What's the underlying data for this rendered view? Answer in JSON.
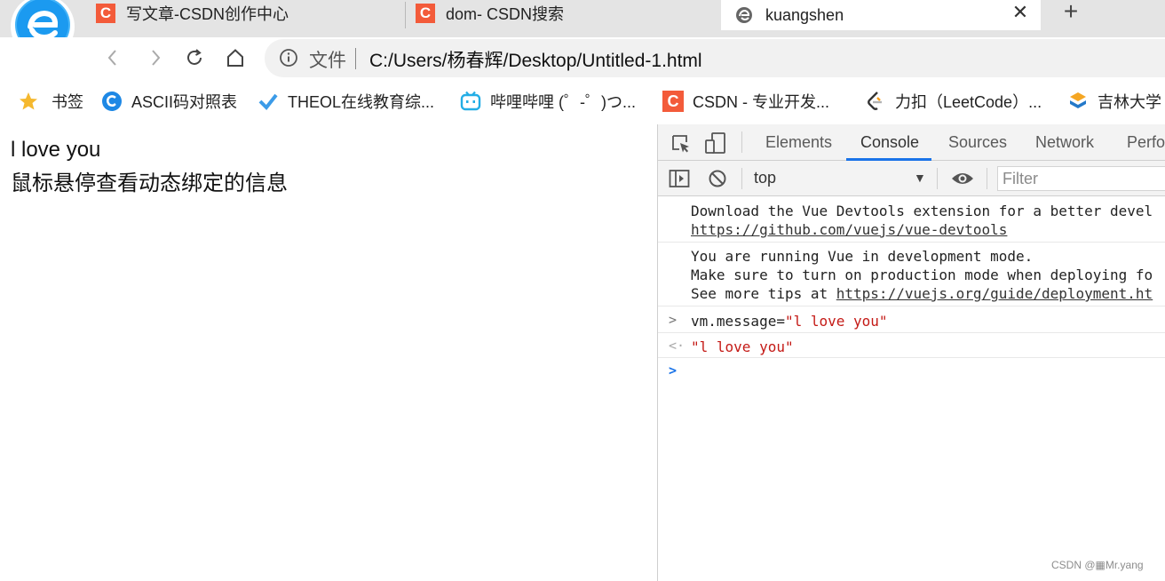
{
  "tabs": [
    {
      "label": "写文章-CSDN创作中心",
      "favicon": "csdn-icon"
    },
    {
      "label": "dom- CSDN搜索",
      "favicon": "csdn-icon"
    },
    {
      "label": "kuangshen",
      "favicon": "page-icon",
      "active": true
    }
  ],
  "address": {
    "scheme_label": "文件",
    "url": "C:/Users/杨春辉/Desktop/Untitled-1.html"
  },
  "bookmarks": [
    {
      "label": "书签",
      "icon": "star-icon"
    },
    {
      "label": "ASCII码对照表",
      "icon": "c-circle-icon"
    },
    {
      "label": "THEOL在线教育综...",
      "icon": "check-icon"
    },
    {
      "label": "哔哩哔哩 (゜-゜)つ...",
      "icon": "bilibili-icon"
    },
    {
      "label": "CSDN - 专业开发...",
      "icon": "csdn-icon"
    },
    {
      "label": "力扣（LeetCode）...",
      "icon": "leetcode-icon"
    },
    {
      "label": "吉林大学",
      "icon": "jlu-icon"
    }
  ],
  "page": {
    "message": "l love you",
    "hint": "鼠标悬停查看动态绑定的信息"
  },
  "devtools": {
    "tabs": [
      "Elements",
      "Console",
      "Sources",
      "Network",
      "Perfor"
    ],
    "active_tab": "Console",
    "context": "top",
    "filter_placeholder": "Filter",
    "console": {
      "line1": "Download the Vue Devtools extension for a better devel",
      "link1": "https://github.com/vuejs/vue-devtools",
      "line2": "You are running Vue in development mode.",
      "line3": "Make sure to turn on production mode when deploying fo",
      "line4_prefix": "See more tips at ",
      "link2": "https://vuejs.org/guide/deployment.ht",
      "input_prefix": "vm.message=",
      "input_value": "\"l love you\"",
      "output_value": "\"l love you\""
    }
  },
  "watermark": "CSDN @▦Mr.yang",
  "colors": {
    "accent": "#1a73e8",
    "csdn": "#f35b3a",
    "string": "#c41a16"
  }
}
